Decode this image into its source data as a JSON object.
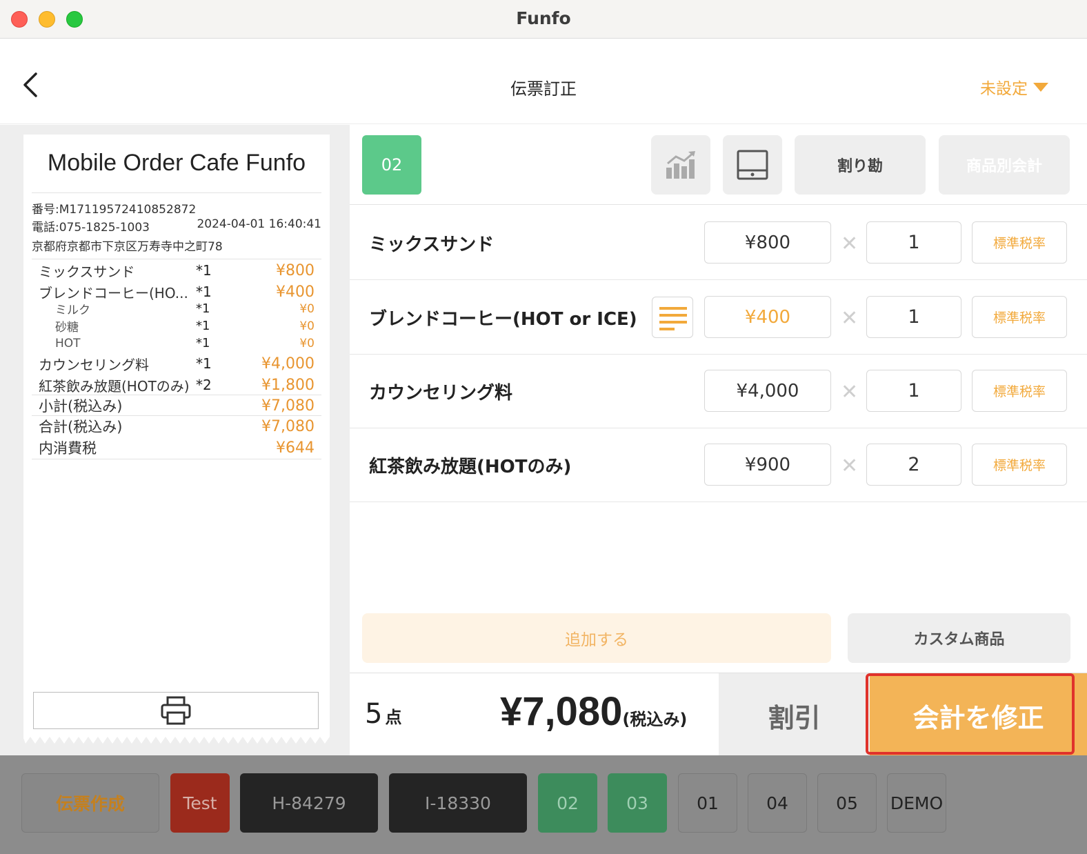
{
  "window": {
    "title": "Funfo"
  },
  "header": {
    "title": "伝票訂正",
    "staff_select": "未設定"
  },
  "receipt": {
    "shop_name": "Mobile Order Cafe Funfo",
    "number": "番号:M17119572410852872",
    "phone": "電話:075-1825-1003",
    "datetime": "2024-04-01 16:40:41",
    "address": "京都府京都市下京区万寿寺中之町78",
    "lines": [
      {
        "name": "ミックスサンド",
        "qty": "*1",
        "price": "¥800",
        "sub": false
      },
      {
        "name": "ブレンドコーヒー(HO...",
        "qty": "*1",
        "price": "¥400",
        "sub": false
      },
      {
        "name": "ミルク",
        "qty": "*1",
        "price": "¥0",
        "sub": true
      },
      {
        "name": "砂糖",
        "qty": "*1",
        "price": "¥0",
        "sub": true
      },
      {
        "name": "HOT",
        "qty": "*1",
        "price": "¥0",
        "sub": true
      },
      {
        "name": "カウンセリング料",
        "qty": "*1",
        "price": "¥4,000",
        "sub": false
      },
      {
        "name": "紅茶飲み放題(HOTのみ)",
        "qty": "*2",
        "price": "¥1,800",
        "sub": false
      }
    ],
    "subtotal_label": "小計(税込み)",
    "subtotal": "¥7,080",
    "total_label": "合計(税込み)",
    "total": "¥7,080",
    "tax_label": "内消費税",
    "tax": "¥644"
  },
  "toolbar": {
    "table": "02",
    "split_label": "割り勘",
    "item_checkout_label": "商品別会計"
  },
  "items": [
    {
      "name": "ミックスサンド",
      "price": "¥800",
      "qty": "1",
      "tax": "標準税率",
      "has_note": false
    },
    {
      "name": "ブレンドコーヒー(HOT or ICE)",
      "price": "¥400",
      "qty": "1",
      "tax": "標準税率",
      "has_note": true
    },
    {
      "name": "カウンセリング料",
      "price": "¥4,000",
      "qty": "1",
      "tax": "標準税率",
      "has_note": false
    },
    {
      "name": "紅茶飲み放題(HOTのみ)",
      "price": "¥900",
      "qty": "2",
      "tax": "標準税率",
      "has_note": false
    }
  ],
  "actions": {
    "add_label": "追加する",
    "custom_label": "カスタム商品"
  },
  "footer": {
    "count": "5",
    "count_unit": "点",
    "total": "¥7,080",
    "total_note": "(税込み)",
    "discount_label": "割引",
    "amend_label": "会計を修正"
  },
  "tabs": [
    {
      "label": "伝票作成",
      "style": "create"
    },
    {
      "label": "Test",
      "style": "red"
    },
    {
      "label": "H-84279",
      "style": "black"
    },
    {
      "label": "I-18330",
      "style": "black"
    },
    {
      "label": "02",
      "style": "green"
    },
    {
      "label": "03",
      "style": "green"
    },
    {
      "label": "01",
      "style": "gray"
    },
    {
      "label": "04",
      "style": "gray"
    },
    {
      "label": "05",
      "style": "gray"
    },
    {
      "label": "DEMO",
      "style": "gray"
    }
  ],
  "colors": {
    "accent": "#f2a93b",
    "primary_button": "#f3b457",
    "table_green": "#5cc98a",
    "highlight_border": "#e0322b"
  }
}
